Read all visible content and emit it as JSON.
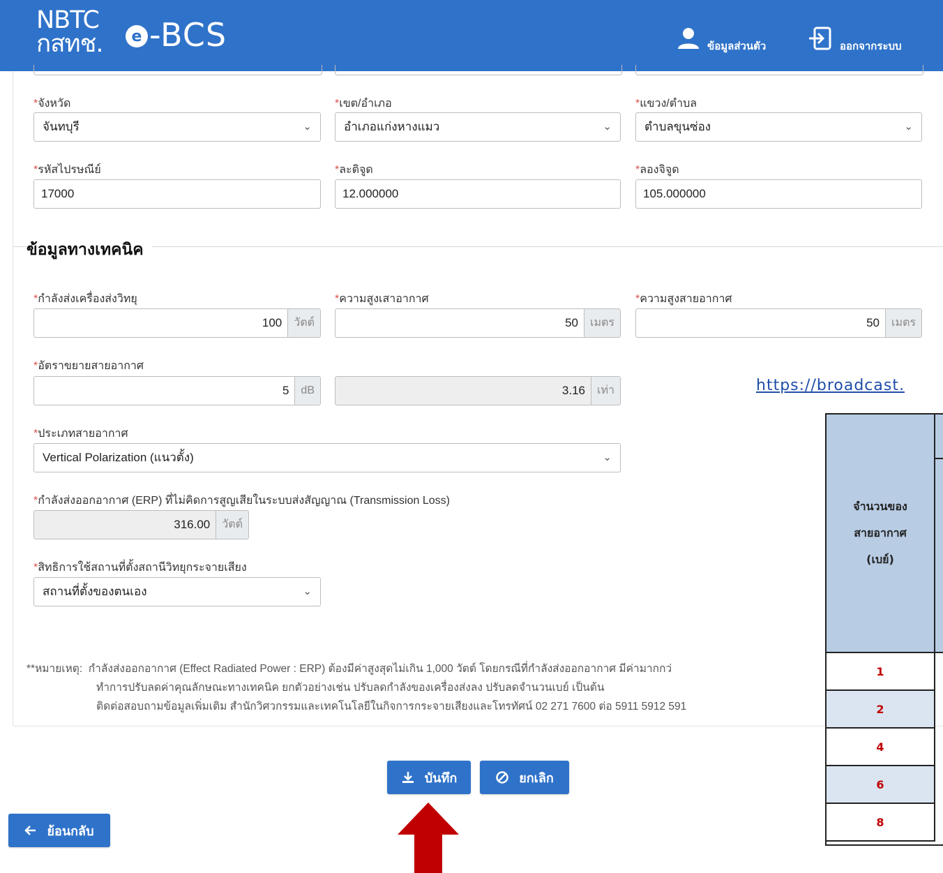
{
  "header": {
    "brand_top": "NBTC",
    "brand_bottom": "กสทช.",
    "app_name": "-BCS",
    "profile_label": "ข้อมูลส่วนตัว",
    "logout_label": "ออกจากระบบ"
  },
  "address": {
    "province": {
      "label": "จังหวัด",
      "value": "จันทบุรี"
    },
    "district": {
      "label": "เขต/อำเภอ",
      "value": "อำเภอแก่งหางแมว"
    },
    "subdistrict": {
      "label": "แขวง/ตำบล",
      "value": "ตำบลขุนซ่อง"
    },
    "postal_code": {
      "label": "รหัสไปรษณีย์",
      "value": "17000"
    },
    "latitude": {
      "label": "ละติจูด",
      "value": "12.000000"
    },
    "longitude": {
      "label": "ลองจิจูด",
      "value": "105.000000"
    }
  },
  "technical": {
    "section_title": "ข้อมูลทางเทคนิค",
    "tx_power": {
      "label": "กำลังส่งเครื่องส่งวิทยุ",
      "value": "100",
      "unit": "วัตต์"
    },
    "mast_height": {
      "label": "ความสูงเสาอากาศ",
      "value": "50",
      "unit": "เมตร"
    },
    "antenna_height": {
      "label": "ความสูงสายอากาศ",
      "value": "50",
      "unit": "เมตร"
    },
    "antenna_gain": {
      "label": "อัตราขยายสายอากาศ",
      "value": "5",
      "unit": "dB"
    },
    "gain_factor": {
      "value": "3.16",
      "unit": "เท่า"
    },
    "antenna_type": {
      "label": "ประเภทสายอากาศ",
      "value": "Vertical Polarization (แนวตั้ง)"
    },
    "erp": {
      "label": "กำลังส่งออกอากาศ (ERP) ที่ไม่คิดการสูญเสียในระบบส่งสัญญาณ (Transmission Loss)",
      "value": "316.00",
      "unit": "วัตต์"
    },
    "site_rights": {
      "label": "สิทธิการใช้สถานที่ตั้งสถานีวิทยุกระจายเสียง",
      "value": "สถานที่ตั้งของตนเอง"
    }
  },
  "required_mark": "*",
  "note": {
    "prefix": "**หมายเหตุ:",
    "line1": "กำลังส่งออกอากาศ (Effect Radiated Power : ERP) ต้องมีค่าสูงสุดไม่เกิน 1,000 วัตต์ โดยกรณีที่กำลังส่งออกอากาศ มีค่ามากกว่",
    "line2": "ทำการปรับลดค่าคุณลักษณะทางเทคนิค ยกตัวอย่างเช่น ปรับลดกำลังของเครื่องส่งลง ปรับลดจำนวนเบย์ เป็นต้น",
    "line3": "ติดต่อสอบถามข้อมูลเพิ่มเติม สำนักวิศวกรรมและเทคโนโลยีในกิจการกระจายเสียงและโทรทัศน์ 02 271 7600 ต่อ 5911 5912 591"
  },
  "buttons": {
    "save": "บันทึก",
    "cancel": "ยกเลิก",
    "back": "ย้อนกลับ"
  },
  "overlay": {
    "url": "https://broadcast.",
    "table_header": [
      "จำนวนของ",
      "สายอากาศ",
      "(เบย์)"
    ],
    "table_rows": [
      "1",
      "2",
      "4",
      "6",
      "8"
    ]
  },
  "colors": {
    "primary": "#2f72c9",
    "arrow": "#c00000",
    "table_header_bg": "#b8cce4"
  }
}
